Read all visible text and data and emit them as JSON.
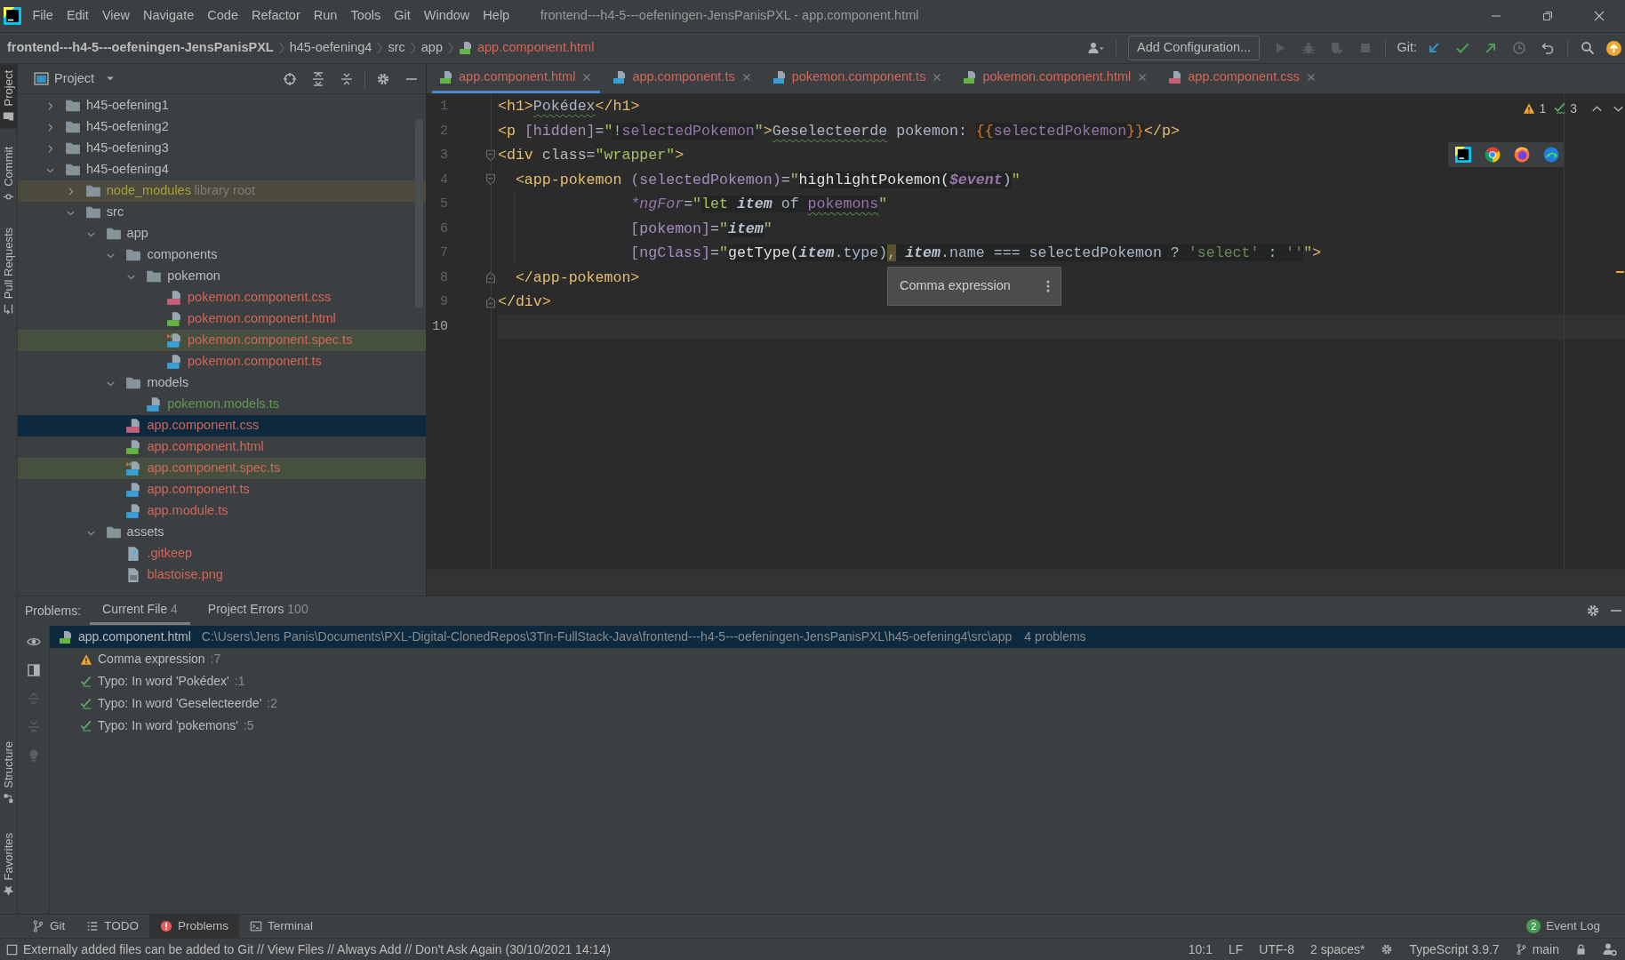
{
  "window": {
    "title": "frontend---h4-5---oefeningen-JensPanisPXL - app.component.html"
  },
  "menu": [
    "File",
    "Edit",
    "View",
    "Navigate",
    "Code",
    "Refactor",
    "Run",
    "Tools",
    "Git",
    "Window",
    "Help"
  ],
  "navigation": {
    "breadcrumbs": [
      {
        "label": "frontend---h4-5---oefeningen-JensPanisPXL",
        "kind": "project",
        "color": "#bbbbbb"
      },
      {
        "label": "h45-oefening4",
        "kind": "folder",
        "color": "#bbbbbb"
      },
      {
        "label": "src",
        "kind": "folder",
        "color": "#bbbbbb"
      },
      {
        "label": "app",
        "kind": "folder",
        "color": "#bbbbbb"
      },
      {
        "label": "app.component.html",
        "kind": "html",
        "color": "#d1675a"
      }
    ],
    "config_button": "Add Configuration...",
    "run_tools": [
      {
        "kind": "run",
        "disabled": true
      },
      {
        "kind": "debug",
        "disabled": true
      },
      {
        "kind": "coverage",
        "disabled": true
      },
      {
        "kind": "stop",
        "disabled": true
      }
    ],
    "git_label": "Git:",
    "git_tools": [
      {
        "kind": "update"
      },
      {
        "kind": "commit"
      },
      {
        "kind": "push"
      },
      {
        "kind": "history"
      },
      {
        "kind": "rollback"
      }
    ]
  },
  "left_stripe": {
    "top": [
      {
        "label": "Project",
        "kind": "project",
        "selected": true
      },
      {
        "label": "Commit",
        "kind": "commit",
        "selected": false
      },
      {
        "label": "Pull Requests",
        "kind": "pull-requests",
        "selected": false
      }
    ],
    "bottom": [
      {
        "label": "Structure",
        "kind": "structure",
        "selected": false
      },
      {
        "label": "Favorites",
        "kind": "favorites",
        "selected": false
      }
    ]
  },
  "project_panel": {
    "title": "Project",
    "tree": [
      {
        "name": "h45-oefening1",
        "kind": "folder",
        "expanded": false,
        "color": "#bbbbbb",
        "selected": false
      },
      {
        "name": "h45-oefening2",
        "kind": "folder",
        "expanded": false,
        "color": "#bbbbbb",
        "selected": false
      },
      {
        "name": "h45-oefening3",
        "kind": "folder",
        "expanded": false,
        "color": "#bbbbbb",
        "selected": false
      },
      {
        "name": "h45-oefening4",
        "kind": "folder",
        "expanded": true,
        "color": "#bbbbbb",
        "selected": false,
        "children": [
          {
            "name": "node_modules",
            "note": "library root",
            "kind": "library",
            "expanded": false,
            "color": "#a6a03c",
            "selected": false
          },
          {
            "name": "src",
            "kind": "folder",
            "expanded": true,
            "color": "#bbbbbb",
            "selected": false,
            "children": [
              {
                "name": "app",
                "kind": "folder",
                "expanded": true,
                "color": "#bbbbbb",
                "selected": false,
                "children": [
                  {
                    "name": "components",
                    "kind": "folder",
                    "expanded": true,
                    "color": "#bbbbbb",
                    "selected": false,
                    "children": [
                      {
                        "name": "pokemon",
                        "kind": "folder",
                        "expanded": true,
                        "color": "#bbbbbb",
                        "selected": false,
                        "children": [
                          {
                            "name": "pokemon.component.css",
                            "kind": "css",
                            "color": "#d1675a",
                            "selected": false
                          },
                          {
                            "name": "pokemon.component.html",
                            "kind": "html",
                            "color": "#d1675a",
                            "selected": false
                          },
                          {
                            "name": "pokemon.component.spec.ts",
                            "kind": "spec",
                            "color": "#d1675a",
                            "selected": false
                          },
                          {
                            "name": "pokemon.component.ts",
                            "kind": "ts",
                            "color": "#d1675a",
                            "selected": false
                          }
                        ]
                      }
                    ]
                  },
                  {
                    "name": "models",
                    "kind": "folder",
                    "expanded": true,
                    "color": "#bbbbbb",
                    "selected": false,
                    "children": [
                      {
                        "name": "pokemon.models.ts",
                        "kind": "ts",
                        "color": "#629755",
                        "selected": false
                      }
                    ]
                  },
                  {
                    "name": "app.component.css",
                    "kind": "css",
                    "color": "#d1675a",
                    "selected": true
                  },
                  {
                    "name": "app.component.html",
                    "kind": "html",
                    "color": "#d1675a",
                    "selected": false
                  },
                  {
                    "name": "app.component.spec.ts",
                    "kind": "spec",
                    "color": "#d1675a",
                    "selected": false
                  },
                  {
                    "name": "app.component.ts",
                    "kind": "ts",
                    "color": "#d1675a",
                    "selected": false
                  },
                  {
                    "name": "app.module.ts",
                    "kind": "ts",
                    "color": "#d1675a",
                    "selected": false
                  }
                ]
              },
              {
                "name": "assets",
                "kind": "folder",
                "expanded": true,
                "color": "#bbbbbb",
                "selected": false,
                "children": [
                  {
                    "name": ".gitkeep",
                    "kind": "unknown",
                    "color": "#d1675a",
                    "selected": false
                  },
                  {
                    "name": "blastoise.png",
                    "kind": "image",
                    "color": "#d1675a",
                    "selected": false
                  }
                ]
              }
            ]
          }
        ]
      }
    ]
  },
  "editor": {
    "tabs": [
      {
        "label": "app.component.html",
        "kind": "html",
        "color": "#d1675a",
        "selected": true
      },
      {
        "label": "app.component.ts",
        "kind": "ts",
        "color": "#d1675a",
        "selected": false
      },
      {
        "label": "pokemon.component.ts",
        "kind": "ts",
        "color": "#d1675a",
        "selected": false
      },
      {
        "label": "pokemon.component.html",
        "kind": "html",
        "color": "#d1675a",
        "selected": false
      },
      {
        "label": "app.component.css",
        "kind": "css",
        "color": "#d1675a",
        "selected": false
      }
    ],
    "lines": [
      {
        "number": "1",
        "kind": "plain",
        "current": false,
        "tokens": [
          {
            "text": "<h1>",
            "kind": "tag"
          },
          {
            "text": "Pokédex",
            "kind": "typo-text"
          },
          {
            "text": "</h1>",
            "kind": "tag"
          }
        ]
      },
      {
        "number": "2",
        "kind": "plain",
        "current": false,
        "tokens": [
          {
            "text": "<p ",
            "kind": "tag"
          },
          {
            "text": "[hidden]",
            "kind": "binding"
          },
          {
            "text": "=",
            "kind": "text"
          },
          {
            "text": "\"",
            "kind": "string"
          },
          {
            "text": "!",
            "kind": "expr"
          },
          {
            "text": "selectedPokemon",
            "kind": "field"
          },
          {
            "text": "\"",
            "kind": "string"
          },
          {
            "text": ">",
            "kind": "tag"
          },
          {
            "text": "Geselecteerde",
            "kind": "typo-text"
          },
          {
            "text": " pokemon: ",
            "kind": "text"
          },
          {
            "text": "{{",
            "kind": "brace"
          },
          {
            "text": "selectedPokemon",
            "kind": "field"
          },
          {
            "text": "}}",
            "kind": "brace"
          },
          {
            "text": "</p>",
            "kind": "tag"
          }
        ]
      },
      {
        "number": "3",
        "kind": "fold-start",
        "current": false,
        "tokens": [
          {
            "text": "<div ",
            "kind": "tag"
          },
          {
            "text": "class",
            "kind": "attr"
          },
          {
            "text": "=",
            "kind": "text"
          },
          {
            "text": "\"wrapper\"",
            "kind": "string"
          },
          {
            "text": ">",
            "kind": "tag"
          }
        ]
      },
      {
        "number": "4",
        "kind": "fold-start",
        "current": false,
        "tokens": [
          {
            "text": "  <app-pokemon ",
            "kind": "tag"
          },
          {
            "text": "(selectedPokemon)",
            "kind": "binding"
          },
          {
            "text": "=",
            "kind": "text"
          },
          {
            "text": "\"",
            "kind": "string"
          },
          {
            "text": "highlightPokemon(",
            "kind": "fn"
          },
          {
            "text": "$event",
            "kind": "param"
          },
          {
            "text": ")",
            "kind": "expr"
          },
          {
            "text": "\"",
            "kind": "string"
          }
        ]
      },
      {
        "number": "5",
        "kind": "plain",
        "current": false,
        "tokens": [
          {
            "text": "               *ngFor",
            "kind": "directive"
          },
          {
            "text": "=",
            "kind": "text"
          },
          {
            "text": "\"",
            "kind": "string"
          },
          {
            "text": "let ",
            "kind": "keyword"
          },
          {
            "text": "item",
            "kind": "local"
          },
          {
            "text": " of ",
            "kind": "expr"
          },
          {
            "text": "pokemons",
            "kind": "typo-field"
          },
          {
            "text": "\"",
            "kind": "string"
          }
        ]
      },
      {
        "number": "6",
        "kind": "plain",
        "current": false,
        "tokens": [
          {
            "text": "               [pokemon]",
            "kind": "binding"
          },
          {
            "text": "=",
            "kind": "text"
          },
          {
            "text": "\"",
            "kind": "string"
          },
          {
            "text": "item",
            "kind": "local"
          },
          {
            "text": "\"",
            "kind": "string"
          }
        ]
      },
      {
        "number": "7",
        "kind": "plain",
        "current": false,
        "tokens": [
          {
            "text": "               [ngClass]",
            "kind": "binding"
          },
          {
            "text": "=",
            "kind": "text"
          },
          {
            "text": "\"",
            "kind": "string"
          },
          {
            "text": "getType(",
            "kind": "fn"
          },
          {
            "text": "item",
            "kind": "local"
          },
          {
            "text": ".type)",
            "kind": "expr"
          },
          {
            "text": ",",
            "kind": "warning-expr"
          },
          {
            "text": " item",
            "kind": "local"
          },
          {
            "text": ".name === selectedPokemon ? ",
            "kind": "expr"
          },
          {
            "text": "'select'",
            "kind": "estring"
          },
          {
            "text": " : ",
            "kind": "expr"
          },
          {
            "text": "''",
            "kind": "estring"
          },
          {
            "text": "\"",
            "kind": "string"
          },
          {
            "text": ">",
            "kind": "tag"
          }
        ]
      },
      {
        "number": "8",
        "kind": "fold-end",
        "current": false,
        "tokens": [
          {
            "text": "  </app-pokemon>",
            "kind": "tag"
          }
        ]
      },
      {
        "number": "9",
        "kind": "fold-end",
        "current": false,
        "tokens": [
          {
            "text": "</div>",
            "kind": "tag"
          }
        ]
      },
      {
        "number": "10",
        "kind": "plain",
        "current": true
      }
    ],
    "inspections": {
      "warnings": "1",
      "typos": "3"
    },
    "tooltip": {
      "text": "Comma expression"
    }
  },
  "problems": {
    "title": "Problems:",
    "tabs": [
      {
        "label": "Current File",
        "count": "4",
        "selected": true
      },
      {
        "label": "Project Errors",
        "count": "100",
        "selected": false
      }
    ],
    "file": {
      "name": "app.component.html",
      "kind": "html",
      "path": "C:\\Users\\Jens Panis\\Documents\\PXL-Digital-ClonedRepos\\3Tin-FullStack-Java\\frontend---h4-5---oefeningen-JensPanisPXL\\h45-oefening4\\src\\app",
      "summary": "4 problems",
      "selected": true
    },
    "items": [
      {
        "kind": "warning",
        "text": "Comma expression",
        "line": ":7",
        "selected": false
      },
      {
        "kind": "typo",
        "text": "Typo: In word 'Pokédex'",
        "line": ":1",
        "selected": false
      },
      {
        "kind": "typo",
        "text": "Typo: In word 'Geselecteerde'",
        "line": ":2",
        "selected": false
      },
      {
        "kind": "typo",
        "text": "Typo: In word 'pokemons'",
        "line": ":5",
        "selected": false
      }
    ]
  },
  "tool_windows": [
    {
      "label": "Git",
      "kind": "git",
      "selected": false
    },
    {
      "label": "TODO",
      "kind": "todo",
      "selected": false
    },
    {
      "label": "Problems",
      "kind": "problems",
      "selected": true
    },
    {
      "label": "Terminal",
      "kind": "terminal",
      "selected": false
    }
  ],
  "event_log": {
    "label": "Event Log",
    "count": "2"
  },
  "status_bar": {
    "message": "Externally added files can be added to Git // View Files // Always Add // Don't Ask Again (30/10/2021 14:14)",
    "position": "10:1",
    "line_separator": "LF",
    "encoding": "UTF-8",
    "indent": "2 spaces*",
    "language": "TypeScript 3.9.7",
    "branch": "main"
  }
}
